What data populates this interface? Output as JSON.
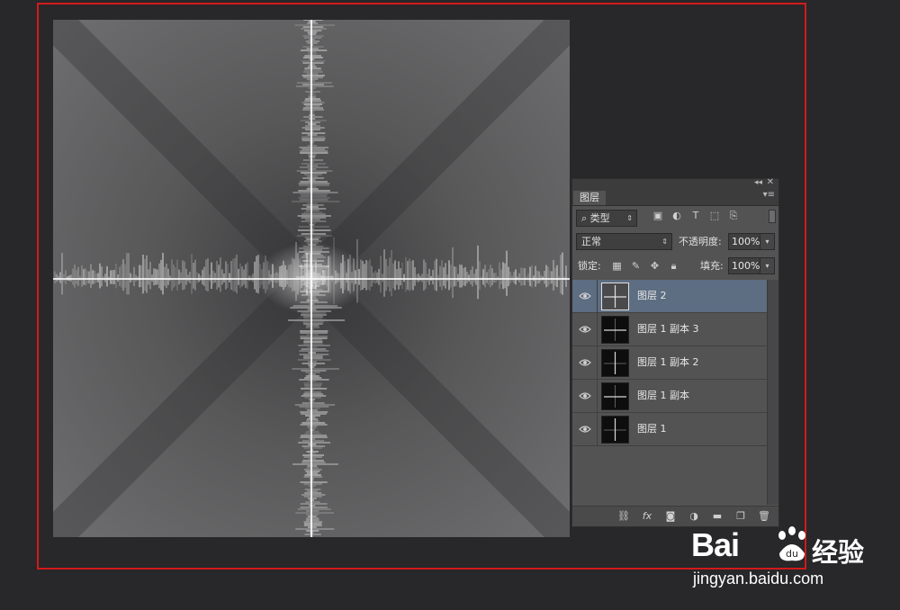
{
  "panel": {
    "collapse_glyph": "◂◂",
    "close_glyph": "✕",
    "tab_label": "图层",
    "tab_menu_glyph": "▾≡",
    "filter": {
      "search_glyph": "⌕",
      "value": "类型",
      "arrow": "⇕"
    },
    "filter_icons": [
      "image-icon",
      "adjustment-circle-icon",
      "type-icon",
      "shape-icon",
      "smart-object-icon"
    ],
    "blend_mode": {
      "value": "正常",
      "arrow": "⇕"
    },
    "opacity": {
      "label": "不透明度:",
      "value": "100%",
      "arrow": "▾"
    },
    "lock": {
      "label": "锁定:"
    },
    "fill": {
      "label": "填充:",
      "value": "100%",
      "arrow": "▾"
    },
    "layers": [
      {
        "name": "图层 2",
        "selected": true
      },
      {
        "name": "图层 1 副本 3",
        "selected": false
      },
      {
        "name": "图层 1 副本 2",
        "selected": false
      },
      {
        "name": "图层 1 副本",
        "selected": false
      },
      {
        "name": "图层 1",
        "selected": false
      }
    ],
    "footer_icons": [
      "link-icon",
      "fx-icon",
      "mask-icon",
      "adjustment-icon",
      "folder-icon",
      "new-layer-icon",
      "trash-icon"
    ]
  },
  "watermark": {
    "brand": "Bai",
    "brand_suffix": "经验",
    "url": "jingyan.baidu.com"
  },
  "colors": {
    "workspace": "#28272a",
    "frame": "#d21a1a",
    "panel": "#535353",
    "selected_layer": "#5d6d82"
  }
}
